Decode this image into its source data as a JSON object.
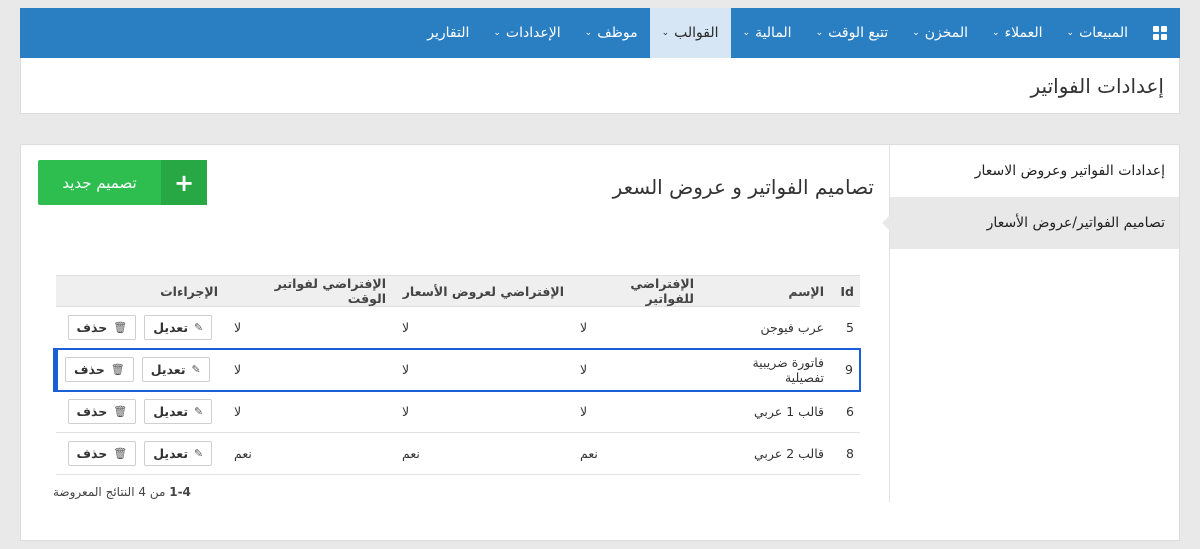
{
  "nav": {
    "items": [
      {
        "label": "المبيعات",
        "chevron": true,
        "active": false
      },
      {
        "label": "العملاء",
        "chevron": true,
        "active": false
      },
      {
        "label": "المخزن",
        "chevron": true,
        "active": false
      },
      {
        "label": "تتبع الوقت",
        "chevron": true,
        "active": false
      },
      {
        "label": "المالية",
        "chevron": true,
        "active": false
      },
      {
        "label": "القوالب",
        "chevron": true,
        "active": true
      },
      {
        "label": "موظف",
        "chevron": true,
        "active": false
      },
      {
        "label": "الإعدادات",
        "chevron": true,
        "active": false
      },
      {
        "label": "التقارير",
        "chevron": false,
        "active": false
      }
    ]
  },
  "page": {
    "title": "إعدادات الفواتير"
  },
  "sidebar": {
    "items": [
      {
        "label": "إعدادات الفواتير وعروض الاسعار",
        "active": false
      },
      {
        "label": "تصاميم الفواتير/عروض الأسعار",
        "active": true
      }
    ]
  },
  "content": {
    "title": "تصاميم الفواتير و عروض السعر",
    "new_button": "تصميم جديد",
    "new_button_icon": "+"
  },
  "table": {
    "headers": {
      "id": "Id",
      "name": "الإسم",
      "invoice_default": "الإفتراضي للفواتير",
      "quote_default": "الإفتراضي لعروض الأسعار",
      "time_default": "الإفتراضي لفواتير الوقت",
      "actions": "الإجراءات"
    },
    "edit_label": "تعديل",
    "delete_label": "حذف",
    "rows": [
      {
        "id": "5",
        "name": "عرب فيوجن",
        "invoice": "لا",
        "quote": "لا",
        "time": "لا"
      },
      {
        "id": "9",
        "name": "فاتورة ضريبية تفصيلية",
        "invoice": "لا",
        "quote": "لا",
        "time": "لا"
      },
      {
        "id": "6",
        "name": "قالب 1 عربي",
        "invoice": "لا",
        "quote": "لا",
        "time": "لا"
      },
      {
        "id": "8",
        "name": "قالب 2 عربي",
        "invoice": "نعم",
        "quote": "نعم",
        "time": "نعم"
      }
    ]
  },
  "results": {
    "range": "1-4",
    "text": "من 4 النتائج المعروضة"
  }
}
